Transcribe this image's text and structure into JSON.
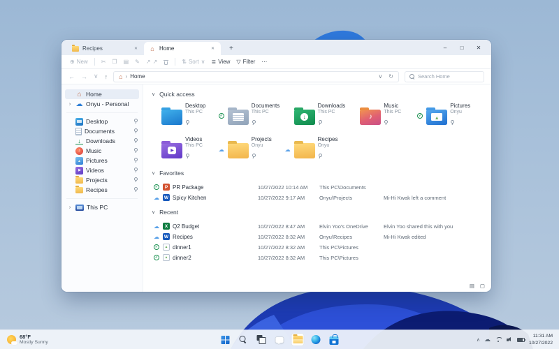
{
  "glyphs": {
    "chevron_down": "∨",
    "chevron_right": "›",
    "chevron_up": "∧",
    "back": "←",
    "forward": "→",
    "dropdown": "∨",
    "up": "↑",
    "refresh": "↻",
    "new_item": "⊕",
    "cut": "✂",
    "copy": "❐",
    "paste": "▤",
    "rename": "✎",
    "share": "↗",
    "sort": "⇅",
    "view": "≣",
    "filter": "▽",
    "more": "⋯",
    "minimize": "–",
    "maximize": "□",
    "close": "✕",
    "tab_close": "✕",
    "new_tab": "+",
    "breadcrumb_sep": "›",
    "details_view": "▤",
    "icons_view": "▢"
  },
  "window": {
    "tabs": [
      {
        "label": "Recipes",
        "icon": "folder",
        "state": ""
      },
      {
        "label": "Home",
        "icon": "home",
        "state": "active"
      }
    ],
    "toolbar": {
      "new": "New",
      "sort": "Sort",
      "view": "View",
      "filter": "Filter"
    },
    "address": {
      "path": "Home",
      "search_placeholder": "Search Home"
    },
    "sidebar": {
      "home": {
        "label": "Home"
      },
      "onedrive": {
        "label": "Onyu - Personal"
      },
      "pinned": [
        {
          "label": "Desktop",
          "icon": "desktop"
        },
        {
          "label": "Documents",
          "icon": "documents"
        },
        {
          "label": "Downloads",
          "icon": "downloads"
        },
        {
          "label": "Music",
          "icon": "music"
        },
        {
          "label": "Pictures",
          "icon": "pictures"
        },
        {
          "label": "Videos",
          "icon": "videos"
        },
        {
          "label": "Projects",
          "icon": "folder"
        },
        {
          "label": "Recipes",
          "icon": "folder"
        }
      ],
      "this_pc": {
        "label": "This PC"
      }
    },
    "quick_access": {
      "title": "Quick access",
      "items": [
        {
          "name": "Desktop",
          "location": "This PC",
          "icon": "desktop",
          "badge": ""
        },
        {
          "name": "Documents",
          "location": "This PC",
          "icon": "documents",
          "badge": "sync"
        },
        {
          "name": "Downloads",
          "location": "This PC",
          "icon": "downloads",
          "badge": ""
        },
        {
          "name": "Music",
          "location": "This PC",
          "icon": "music",
          "badge": ""
        },
        {
          "name": "Pictures",
          "location": "Onyu",
          "icon": "pictures",
          "badge": "sync"
        },
        {
          "name": "Videos",
          "location": "This PC",
          "icon": "videos",
          "badge": ""
        },
        {
          "name": "Projects",
          "location": "Onyu",
          "icon": "folder",
          "badge": "cloud"
        },
        {
          "name": "Recipes",
          "location": "Onyu",
          "icon": "folder",
          "badge": "cloud"
        }
      ]
    },
    "favorites": {
      "title": "Favorites",
      "rows": [
        {
          "name": "PR Package",
          "date": "10/27/2022 10:14 AM",
          "location": "This PC\\Documents",
          "activity": "",
          "file": "powerpoint",
          "badge": "sync"
        },
        {
          "name": "Spicy Kitchen",
          "date": "10/27/2022 9:17 AM",
          "location": "Onyu\\Projects",
          "activity": "Mi-Hi Kwak left a comment",
          "file": "word",
          "badge": "cloud"
        }
      ]
    },
    "recent": {
      "title": "Recent",
      "rows": [
        {
          "name": "Q2 Budget",
          "date": "10/27/2022 8:47 AM",
          "location": "Elvin Yoo's OneDrive",
          "activity": "Elvin Yoo shared this with you",
          "file": "excel",
          "badge": "cloud"
        },
        {
          "name": "Recipes",
          "date": "10/27/2022 8:32 AM",
          "location": "Onyu\\Recipes",
          "activity": "Mi-Hi Kwak edited",
          "file": "word",
          "badge": "cloud"
        },
        {
          "name": "dinner1",
          "date": "10/27/2022 8:32 AM",
          "location": "This PC\\Pictures",
          "activity": "",
          "file": "image",
          "badge": "sync"
        },
        {
          "name": "dinner2",
          "date": "10/27/2022 8:32 AM",
          "location": "This PC\\Pictures",
          "activity": "",
          "file": "image",
          "badge": "sync"
        }
      ]
    }
  },
  "taskbar": {
    "weather": {
      "temperature": "68°F",
      "condition": "Mostly Sunny"
    },
    "apps": [
      "start",
      "search",
      "task-view",
      "chat",
      "file-explorer",
      "edge",
      "store"
    ],
    "tray": {
      "icons": [
        "hidden-icons-chevron",
        "onedrive-cloud",
        "wifi",
        "volume",
        "battery"
      ],
      "time": "11:31 AM",
      "date": "10/27/2022"
    }
  }
}
